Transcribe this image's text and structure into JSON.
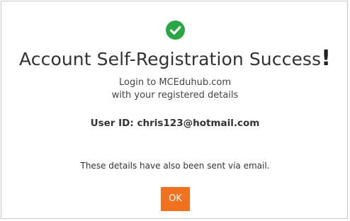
{
  "dialog": {
    "title": "Account Self-Registration Success",
    "title_exclaim": "!",
    "subtitle_line1": "Login to MCEduhub.com",
    "subtitle_line2": "with your registered details",
    "user_id_text": "User ID: chris123@hotmail.com",
    "note": "These details have also been sent via email.",
    "ok_label": "OK",
    "icon": "check-circle-icon",
    "colors": {
      "success": "#27a844",
      "button": "#f2711c",
      "border": "#c8c8c8",
      "text": "#333333"
    }
  }
}
